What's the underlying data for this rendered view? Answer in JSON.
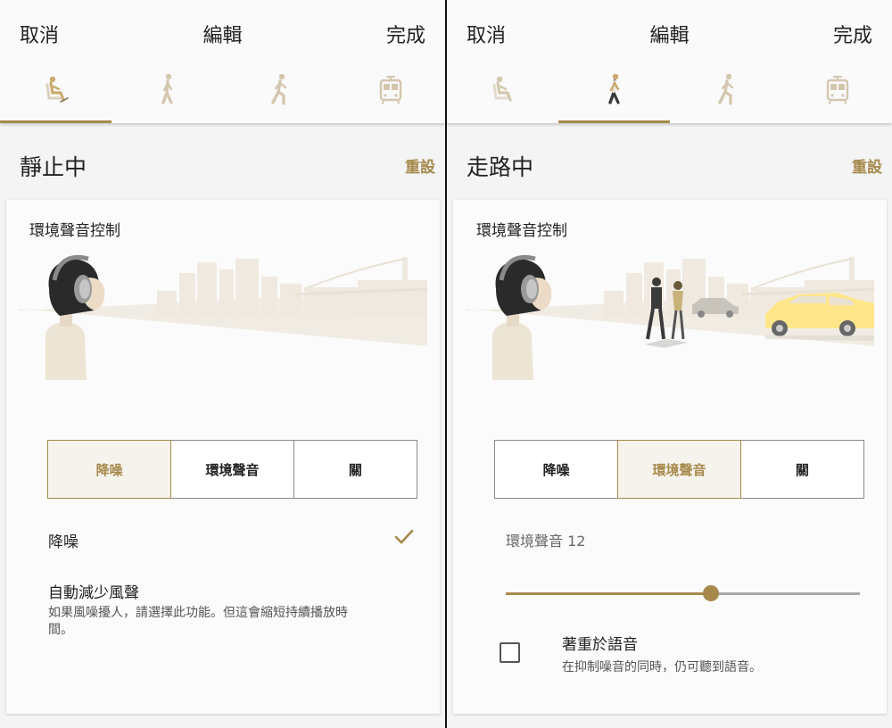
{
  "colors": {
    "accent": "#a6894b",
    "header_bg": "#fafafa",
    "page_bg": "#f4f4f4"
  },
  "left": {
    "header": {
      "cancel": "取消",
      "title": "編輯",
      "done": "完成"
    },
    "tabs": [
      {
        "icon": "sitting-person-icon",
        "active": true
      },
      {
        "icon": "walking-person-icon",
        "active": false
      },
      {
        "icon": "running-person-icon",
        "active": false
      },
      {
        "icon": "train-icon",
        "active": false
      }
    ],
    "section_title": "靜止中",
    "reset": "重設",
    "card": {
      "label": "環境聲音控制",
      "modes": [
        "降噪",
        "環境聲音",
        "關"
      ],
      "selected_mode": "降噪",
      "nc_label": "降噪",
      "wind_title": "自動減少風聲",
      "wind_desc": "如果風噪擾人，請選擇此功能。但這會縮短持續播放時間。"
    }
  },
  "right": {
    "header": {
      "cancel": "取消",
      "title": "編輯",
      "done": "完成"
    },
    "tabs": [
      {
        "icon": "sitting-person-icon",
        "active": false
      },
      {
        "icon": "walking-person-icon",
        "active": true
      },
      {
        "icon": "running-person-icon",
        "active": false
      },
      {
        "icon": "train-icon",
        "active": false
      }
    ],
    "section_title": "走路中",
    "reset": "重設",
    "card": {
      "label": "環境聲音控制",
      "modes": [
        "降噪",
        "環境聲音",
        "關"
      ],
      "selected_mode": "環境聲音",
      "ambient_label": "環境聲音 12",
      "ambient_level": 12,
      "ambient_level_fraction": 0.58,
      "voice_title": "著重於語音",
      "voice_desc": "在抑制噪音的同時，仍可聽到語音。",
      "voice_checked": false
    }
  }
}
